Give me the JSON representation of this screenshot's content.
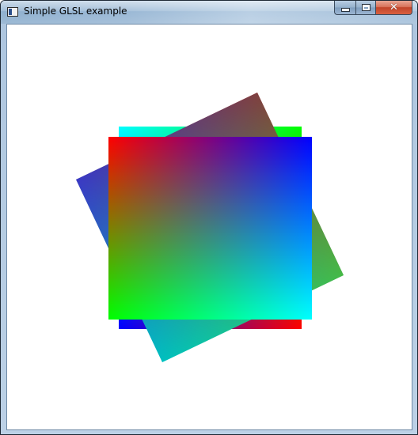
{
  "window": {
    "title": "Simple GLSL example",
    "app_icon": "window-app-icon"
  },
  "caption_buttons": {
    "minimize": {
      "icon": "minimize-icon",
      "glyph": ""
    },
    "maximize": {
      "icon": "maximize-icon",
      "glyph": ""
    },
    "close": {
      "icon": "close-icon",
      "glyph": "✕"
    }
  },
  "scene": {
    "background": "#ffffff",
    "colors": {
      "red": "#ff0000",
      "green": "#00ff00",
      "blue": "#0000ff",
      "cyan": "#00ffff"
    }
  }
}
